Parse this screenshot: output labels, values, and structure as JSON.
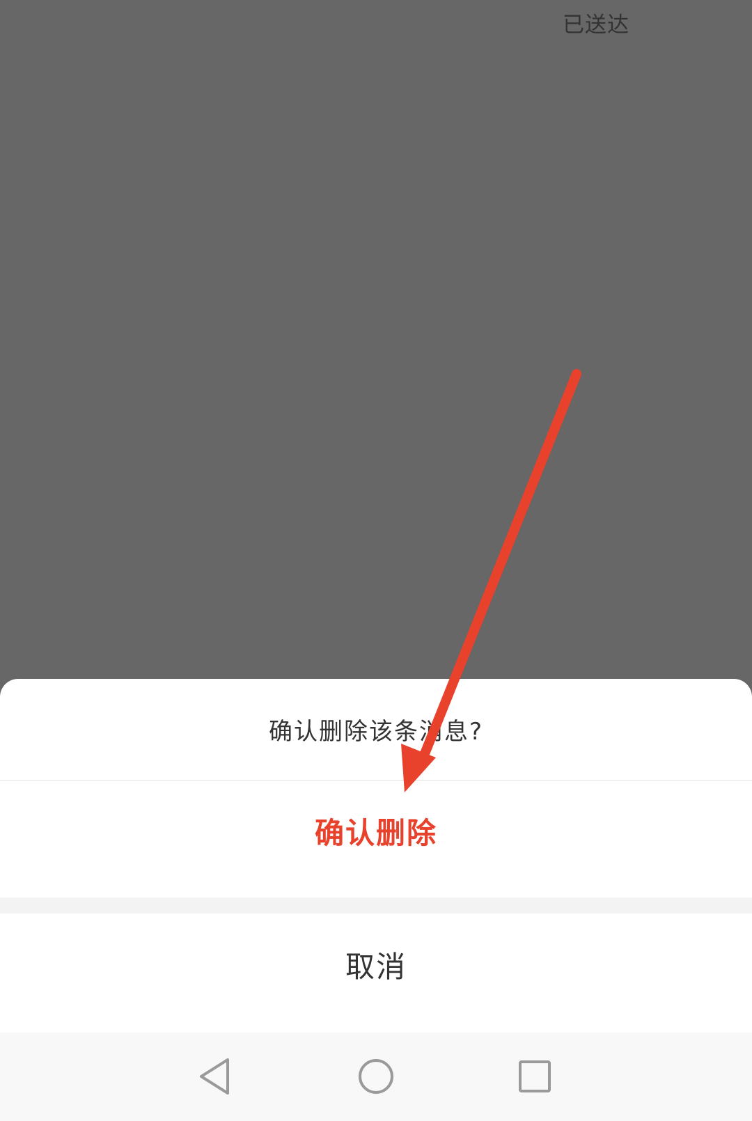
{
  "status": {
    "delivered_text": "已送达"
  },
  "dialog": {
    "title": "确认删除该条消息?",
    "confirm_label": "确认删除",
    "cancel_label": "取消"
  },
  "navigation": {
    "back_icon": "back-triangle-icon",
    "home_icon": "home-circle-icon",
    "recents_icon": "recents-square-icon"
  },
  "colors": {
    "overlay": "#676767",
    "confirm_text": "#e8412c",
    "annotation_arrow": "#e8412c"
  }
}
